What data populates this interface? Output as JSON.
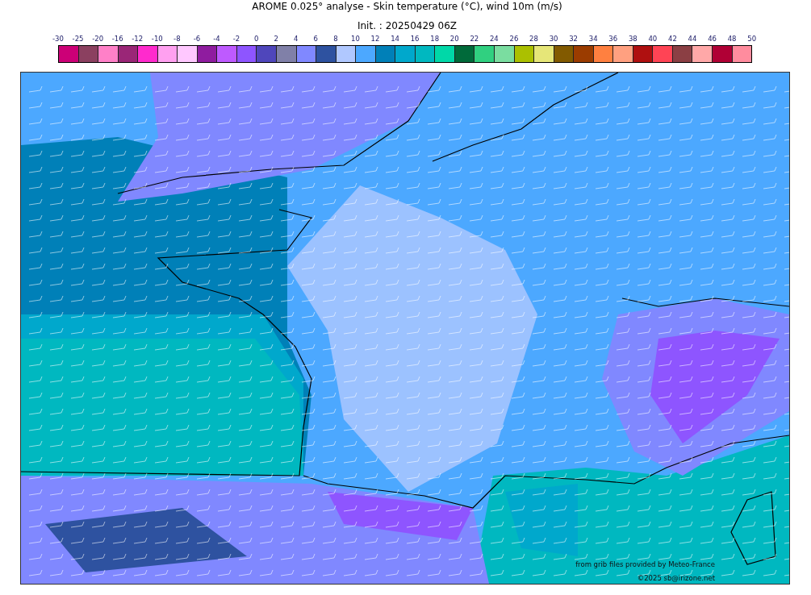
{
  "title": "AROME 0.025° analyse - Skin temperature (°C), wind 10m (m/s)",
  "subtitle": "Init. : 20250429 06Z",
  "colorbar": {
    "ticks": [
      "-30",
      "-25",
      "-20",
      "-16",
      "-12",
      "-10",
      "-8",
      "-6",
      "-4",
      "-2",
      "0",
      "2",
      "4",
      "6",
      "8",
      "10",
      "12",
      "14",
      "16",
      "18",
      "20",
      "22",
      "24",
      "26",
      "28",
      "30",
      "32",
      "34",
      "36",
      "38",
      "40",
      "42",
      "44",
      "46",
      "48",
      "50"
    ],
    "swatches": [
      {
        "color": "#cc0077"
      },
      {
        "color": "#8b4060"
      },
      {
        "color": "#ff80c8"
      },
      {
        "color": "#9a2677"
      },
      {
        "color": "#ff2acd"
      },
      {
        "color": "#ffa0f0"
      },
      {
        "color": "#ffc8ff"
      },
      {
        "color": "#8f1c9f"
      },
      {
        "color": "#be5aff"
      },
      {
        "color": "#8e55ff"
      },
      {
        "color": "#4f46bb"
      },
      {
        "color": "#8080a8"
      },
      {
        "color": "#8088ff"
      },
      {
        "color": "#2e52a0"
      },
      {
        "color": "#b0c8ff"
      },
      {
        "color": "#4ca8ff"
      },
      {
        "color": "#0080b8"
      },
      {
        "color": "#00a8cc"
      },
      {
        "color": "#00b8c0"
      },
      {
        "color": "#00d8a8"
      },
      {
        "color": "#006a3a"
      },
      {
        "color": "#30d080"
      },
      {
        "color": "#7adda0"
      },
      {
        "color": "#abc000"
      },
      {
        "color": "#e6e678"
      },
      {
        "color": "#825a00"
      },
      {
        "color": "#9b3c00"
      },
      {
        "color": "#ff8040"
      },
      {
        "color": "#ffa080"
      },
      {
        "color": "#af1010"
      },
      {
        "color": "#ff4455"
      },
      {
        "color": "#8b3f44"
      },
      {
        "color": "#ffa8a8"
      },
      {
        "color": "#b00035"
      },
      {
        "color": "#ff8c9e"
      }
    ]
  },
  "map": {
    "credits": [
      "from grib files provided by Meteo-France",
      "©2025 sb@irizone.net"
    ]
  }
}
